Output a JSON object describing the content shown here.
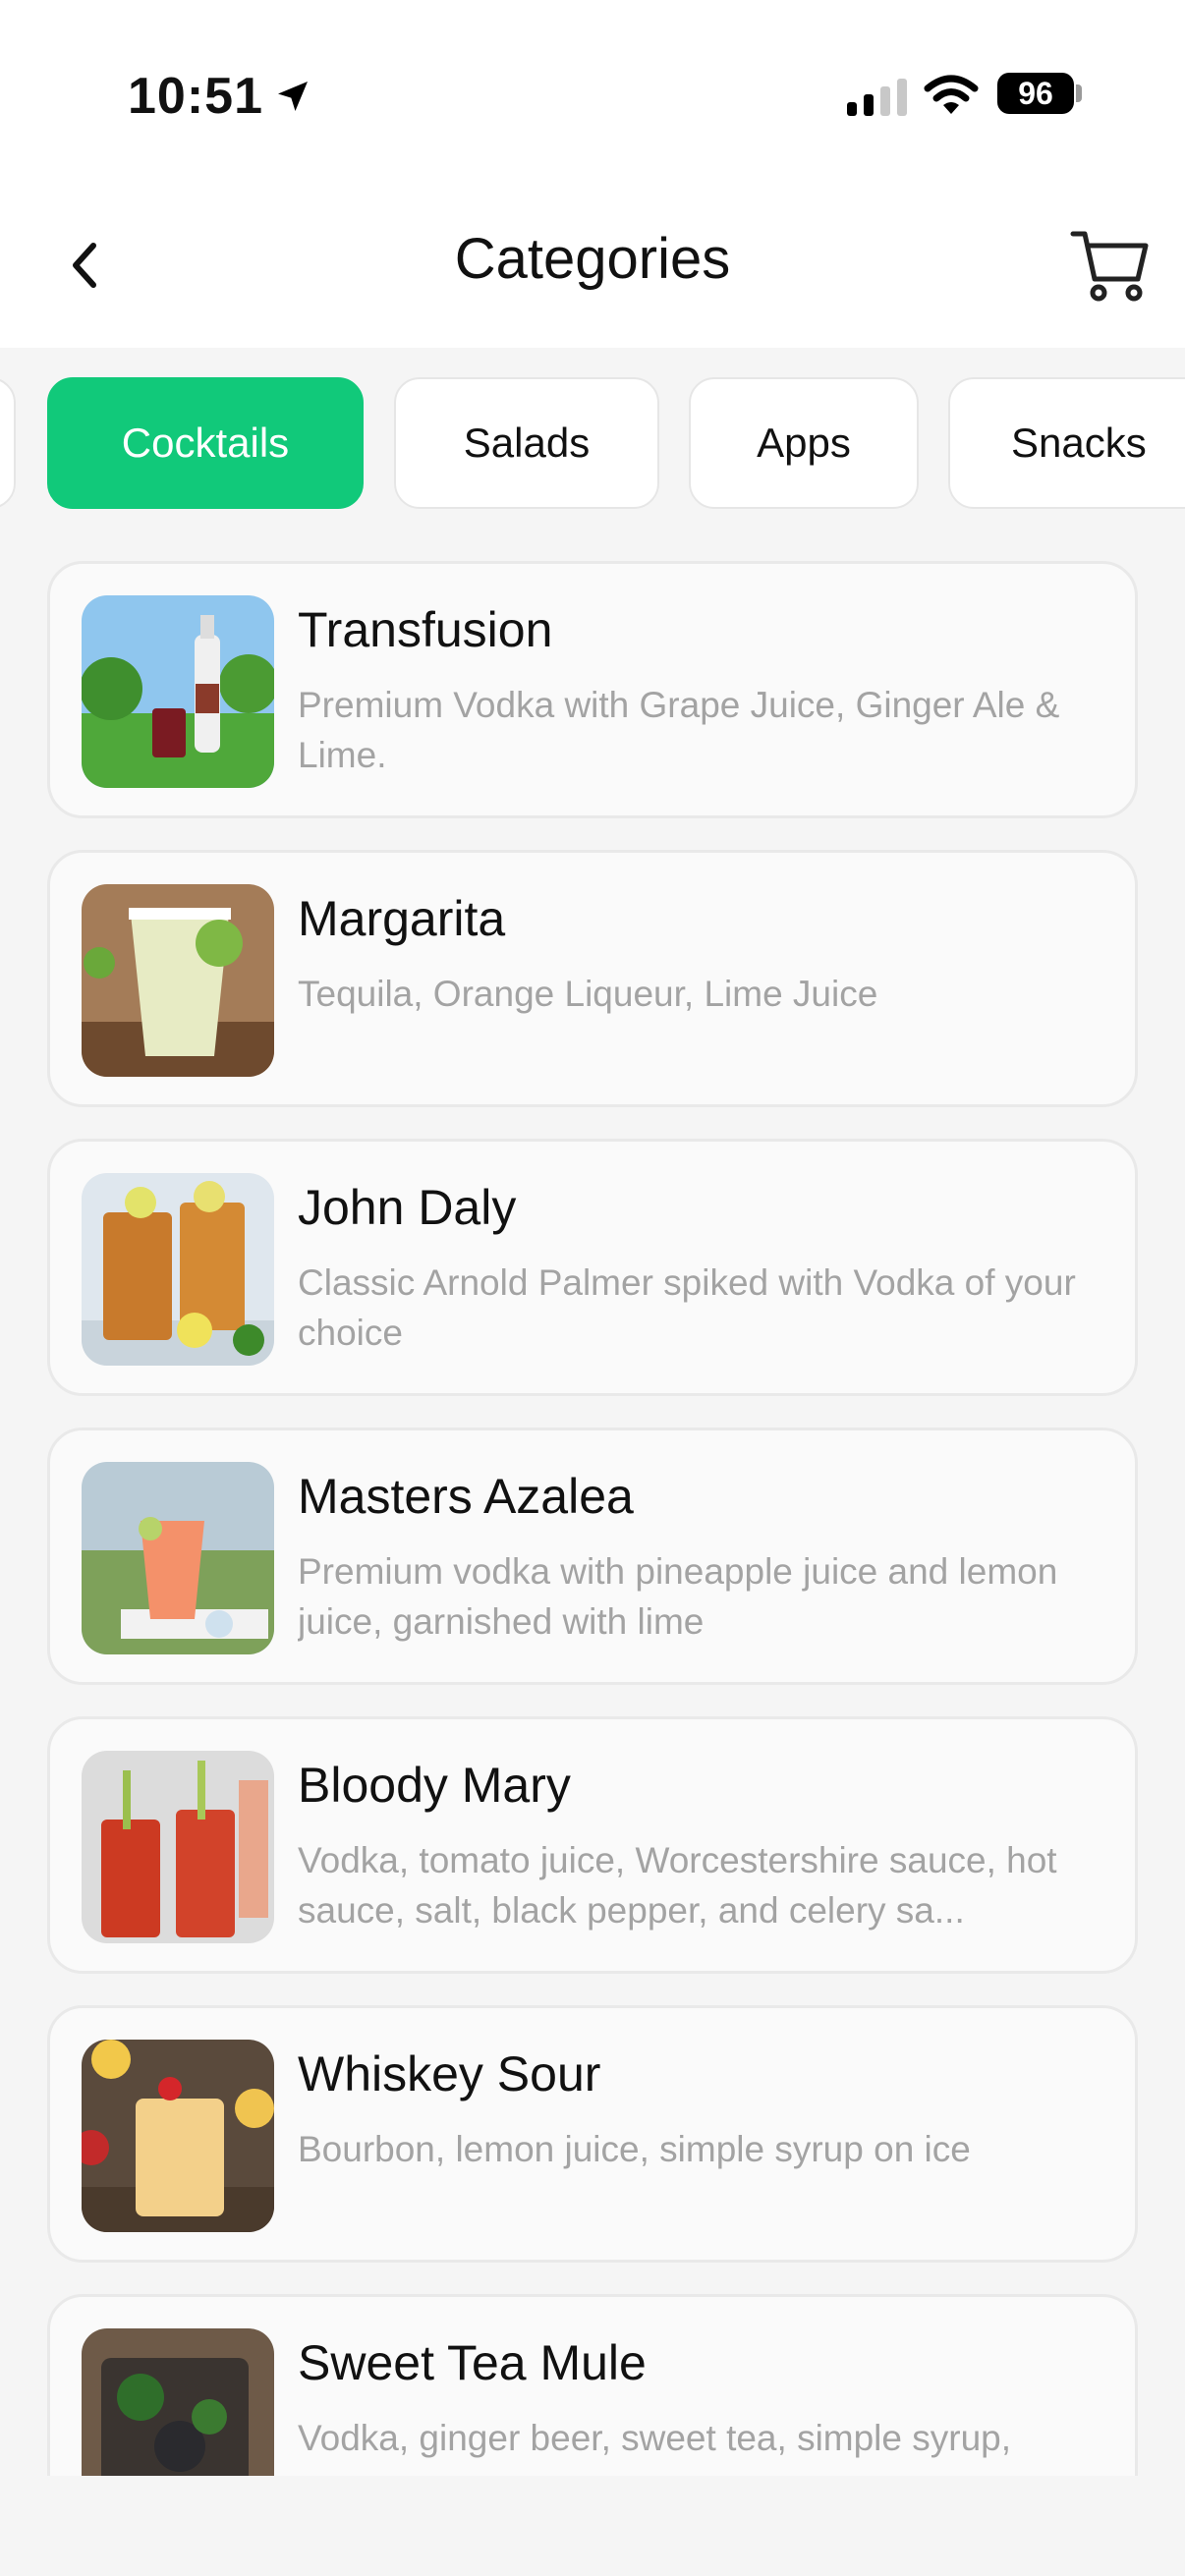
{
  "status_bar": {
    "time": "10:51",
    "battery": "96"
  },
  "header": {
    "title": "Categories"
  },
  "tabs": [
    {
      "label": "Cocktails",
      "active": true
    },
    {
      "label": "Salads",
      "active": false
    },
    {
      "label": "Apps",
      "active": false
    },
    {
      "label": "Snacks",
      "active": false
    }
  ],
  "items": [
    {
      "name": "Transfusion",
      "description": "Premium Vodka with Grape Juice, Ginger Ale & Lime."
    },
    {
      "name": "Margarita",
      "description": "Tequila, Orange Liqueur, Lime Juice"
    },
    {
      "name": "John Daly",
      "description": "Classic Arnold Palmer spiked with Vodka of your choice"
    },
    {
      "name": "Masters Azalea",
      "description": "Premium vodka with pineapple juice and lemon juice, garnished with lime"
    },
    {
      "name": "Bloody Mary",
      "description": "Vodka, tomato juice, Worcestershire sauce, hot sauce, salt, black pepper, and celery sa..."
    },
    {
      "name": "Whiskey Sour",
      "description": "Bourbon, lemon juice, simple syrup on ice"
    },
    {
      "name": "Sweet Tea Mule",
      "description": "Vodka, ginger beer, sweet tea, simple syrup,"
    }
  ],
  "colors": {
    "accent": "#11c97a",
    "muted_text": "#a3a3a3",
    "card_border": "#e9e9e9"
  }
}
